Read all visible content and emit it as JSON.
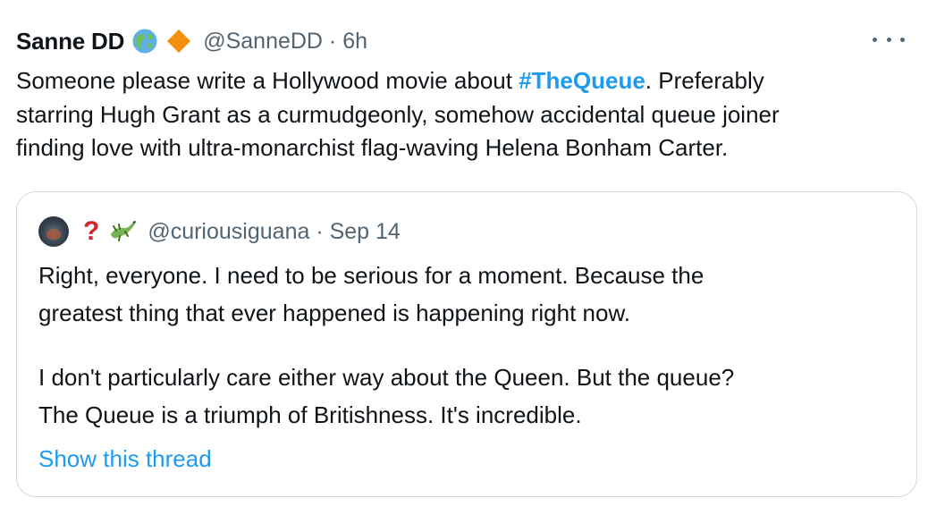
{
  "tweet": {
    "author": {
      "display_name": "Sanne DD",
      "badges": [
        "globe-icon",
        "orange-diamond-icon"
      ],
      "handle_meta": "@SanneDD · 6h"
    },
    "more_icon": "ellipsis-icon",
    "text": {
      "line1_before": "Someone please write a Hollywood movie about ",
      "hashtag": "#TheQueue",
      "line1_after": ". Preferably",
      "line2": "starring Hugh Grant as a curmudgeonly, somehow accidental queue joiner",
      "line3": "finding love with ultra-monarchist flag-waving Helena Bonham Carter."
    },
    "colors": {
      "accent": "#1d9bf0",
      "muted": "#536471",
      "border": "#cfd9de",
      "qmark": "#d3262a"
    }
  },
  "quote": {
    "author": {
      "badges": [
        "red-question-mark-icon",
        "lizard-icon"
      ],
      "handle_meta": "@curiousiguana · Sep 14"
    },
    "para1_line1": "Right, everyone. I need to be serious for a moment. Because the",
    "para1_line2": "greatest thing that ever happened is happening right now.",
    "para2_line1": "I don't particularly care either way about the Queen. But the queue?",
    "para2_line2": "The Queue is a triumph of Britishness. It's incredible.",
    "show_thread": "Show this thread",
    "qmark": "?"
  }
}
